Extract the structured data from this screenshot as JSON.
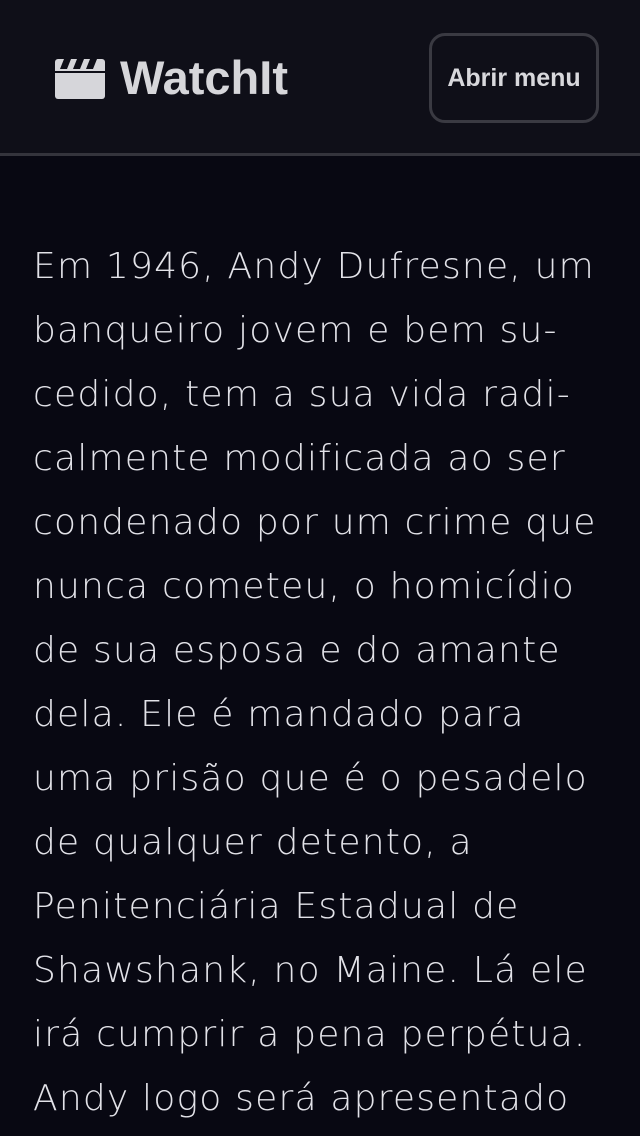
{
  "header": {
    "brand_icon": "clapperboard-icon",
    "brand_name": "WatchIt",
    "menu_button_label": "Abrir menu"
  },
  "main": {
    "synopsis_lines": [
      "Em 1946, Andy Dufresne, um",
      "banqueiro jovem e bem su-",
      "cedido, tem a sua vida radi-",
      "calmente modificada ao ser",
      "condenado por um crime que",
      "nunca cometeu, o homicídio",
      "de sua esposa e do amante",
      "dela. Ele é mandado para",
      "uma prisão que é o pesadelo",
      "de qualquer detento, a",
      "Penitenciária Estadual de",
      "Shawshank, no Maine. Lá ele",
      "irá cumprir a pena perpétua.",
      "Andy logo será apresentado"
    ]
  },
  "colors": {
    "page_background": "#080812",
    "header_background": "#0f0f18",
    "header_border": "#34343c",
    "text": "#e2e2e8"
  }
}
